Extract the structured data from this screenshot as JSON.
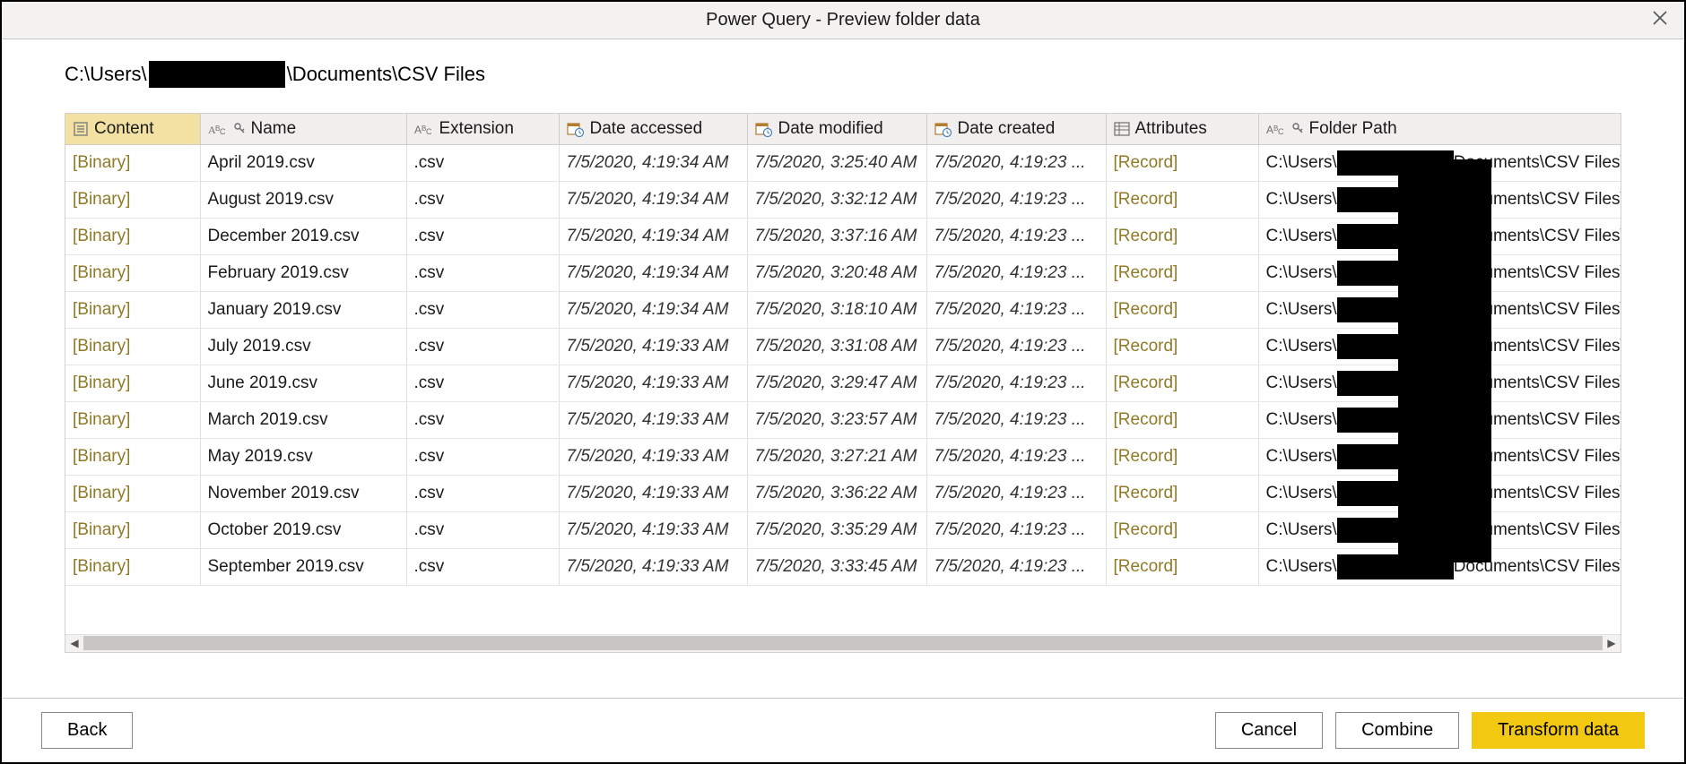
{
  "title": "Power Query - Preview folder data",
  "path": {
    "prefix": "C:\\Users\\",
    "suffix": "\\Documents\\CSV Files"
  },
  "columns": {
    "content": "Content",
    "name": "Name",
    "extension": "Extension",
    "date_accessed": "Date accessed",
    "date_modified": "Date modified",
    "date_created": "Date created",
    "attributes": "Attributes",
    "folder_path": "Folder Path"
  },
  "folder_path_cell": {
    "prefix": "C:\\Users\\",
    "suffix": "Documents\\CSV Files\\"
  },
  "rows": [
    {
      "content": "[Binary]",
      "name": "April 2019.csv",
      "ext": ".csv",
      "da": "7/5/2020, 4:19:34 AM",
      "dm": "7/5/2020, 3:25:40 AM",
      "dc": "7/5/2020, 4:19:23 ...",
      "attr": "[Record]"
    },
    {
      "content": "[Binary]",
      "name": "August 2019.csv",
      "ext": ".csv",
      "da": "7/5/2020, 4:19:34 AM",
      "dm": "7/5/2020, 3:32:12 AM",
      "dc": "7/5/2020, 4:19:23 ...",
      "attr": "[Record]"
    },
    {
      "content": "[Binary]",
      "name": "December 2019.csv",
      "ext": ".csv",
      "da": "7/5/2020, 4:19:34 AM",
      "dm": "7/5/2020, 3:37:16 AM",
      "dc": "7/5/2020, 4:19:23 ...",
      "attr": "[Record]"
    },
    {
      "content": "[Binary]",
      "name": "February 2019.csv",
      "ext": ".csv",
      "da": "7/5/2020, 4:19:34 AM",
      "dm": "7/5/2020, 3:20:48 AM",
      "dc": "7/5/2020, 4:19:23 ...",
      "attr": "[Record]"
    },
    {
      "content": "[Binary]",
      "name": "January 2019.csv",
      "ext": ".csv",
      "da": "7/5/2020, 4:19:34 AM",
      "dm": "7/5/2020, 3:18:10 AM",
      "dc": "7/5/2020, 4:19:23 ...",
      "attr": "[Record]"
    },
    {
      "content": "[Binary]",
      "name": "July 2019.csv",
      "ext": ".csv",
      "da": "7/5/2020, 4:19:33 AM",
      "dm": "7/5/2020, 3:31:08 AM",
      "dc": "7/5/2020, 4:19:23 ...",
      "attr": "[Record]"
    },
    {
      "content": "[Binary]",
      "name": "June 2019.csv",
      "ext": ".csv",
      "da": "7/5/2020, 4:19:33 AM",
      "dm": "7/5/2020, 3:29:47 AM",
      "dc": "7/5/2020, 4:19:23 ...",
      "attr": "[Record]"
    },
    {
      "content": "[Binary]",
      "name": "March 2019.csv",
      "ext": ".csv",
      "da": "7/5/2020, 4:19:33 AM",
      "dm": "7/5/2020, 3:23:57 AM",
      "dc": "7/5/2020, 4:19:23 ...",
      "attr": "[Record]"
    },
    {
      "content": "[Binary]",
      "name": "May 2019.csv",
      "ext": ".csv",
      "da": "7/5/2020, 4:19:33 AM",
      "dm": "7/5/2020, 3:27:21 AM",
      "dc": "7/5/2020, 4:19:23 ...",
      "attr": "[Record]"
    },
    {
      "content": "[Binary]",
      "name": "November 2019.csv",
      "ext": ".csv",
      "da": "7/5/2020, 4:19:33 AM",
      "dm": "7/5/2020, 3:36:22 AM",
      "dc": "7/5/2020, 4:19:23 ...",
      "attr": "[Record]"
    },
    {
      "content": "[Binary]",
      "name": "October 2019.csv",
      "ext": ".csv",
      "da": "7/5/2020, 4:19:33 AM",
      "dm": "7/5/2020, 3:35:29 AM",
      "dc": "7/5/2020, 4:19:23 ...",
      "attr": "[Record]"
    },
    {
      "content": "[Binary]",
      "name": "September 2019.csv",
      "ext": ".csv",
      "da": "7/5/2020, 4:19:33 AM",
      "dm": "7/5/2020, 3:33:45 AM",
      "dc": "7/5/2020, 4:19:23 ...",
      "attr": "[Record]"
    }
  ],
  "buttons": {
    "back": "Back",
    "cancel": "Cancel",
    "combine": "Combine",
    "transform": "Transform data"
  }
}
